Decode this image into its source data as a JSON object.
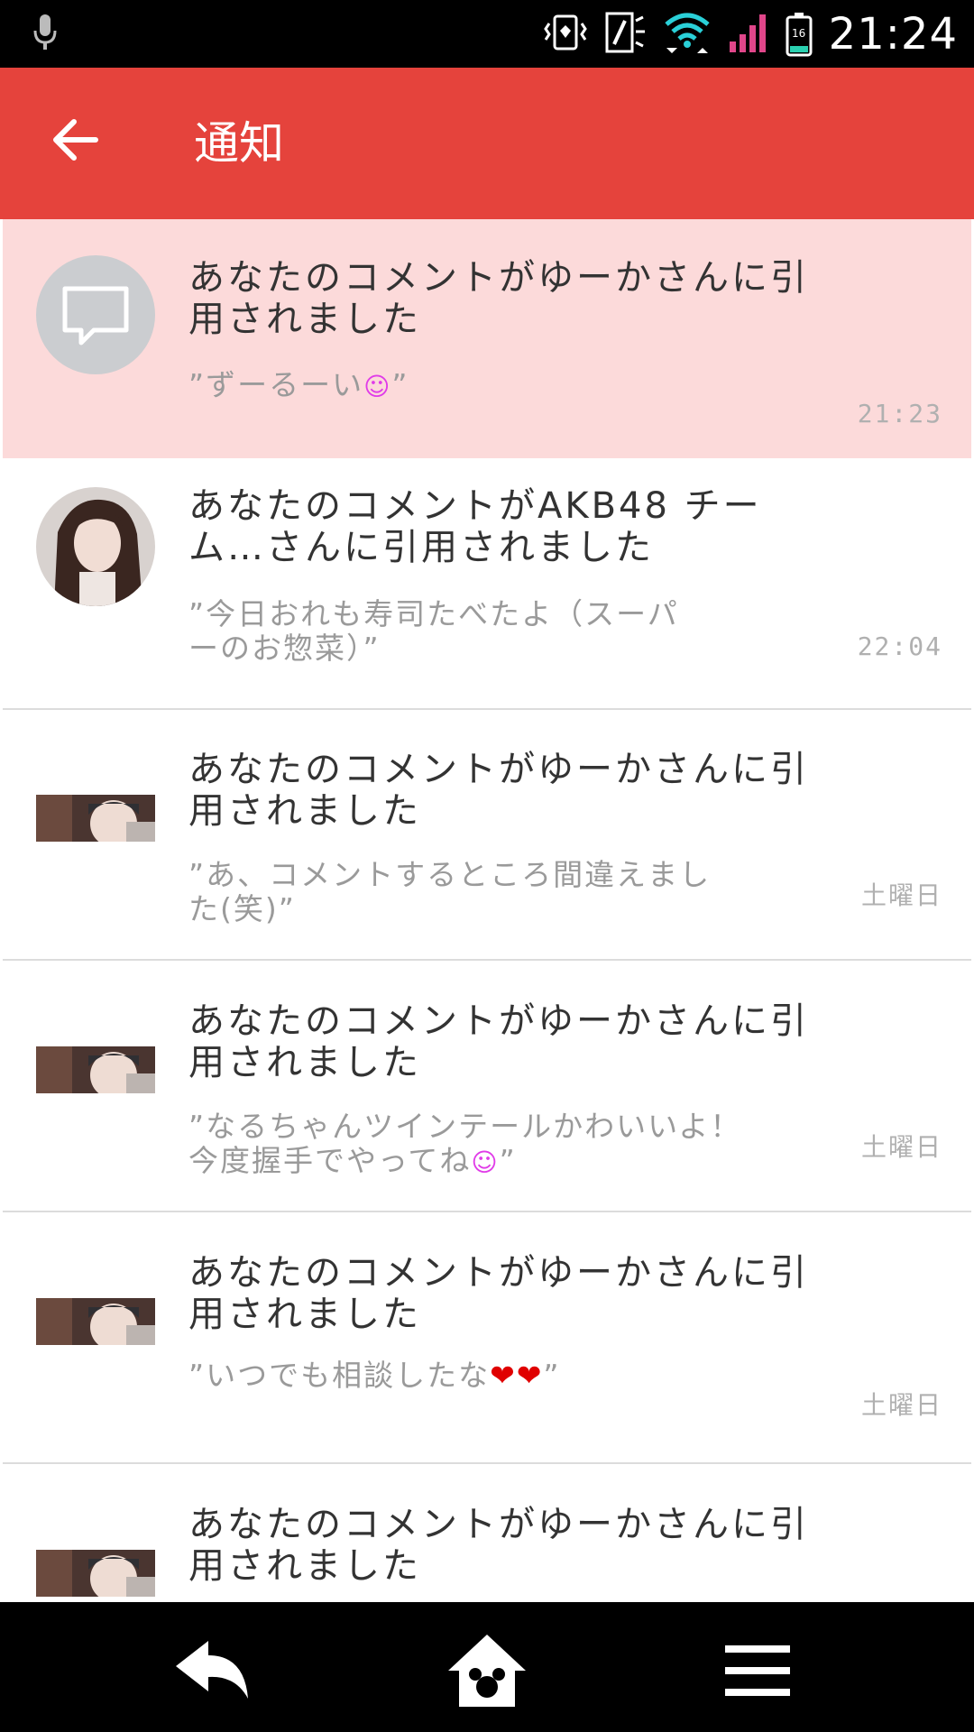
{
  "status_bar": {
    "time": "21:24",
    "battery_level": "16",
    "icons": [
      "mic-icon",
      "vibrate-icon",
      "nfc-icon",
      "wifi-icon",
      "signal-icon",
      "battery-icon"
    ],
    "signal_color": "#e0468a"
  },
  "app_bar": {
    "title": "通知",
    "color": "#e5433c"
  },
  "notifications": [
    {
      "title": "あなたのコメントがゆーかさんに引用されました",
      "quote_text": "”ずーるーい",
      "quote_emoji": "☺",
      "quote_end": "”",
      "time": "21:23",
      "unread": true,
      "avatar": "comment-icon"
    },
    {
      "title": "あなたのコメントがAKB48 チーム…さんに引用されました",
      "quote_text": "”今日おれも寿司たべたよ（スーパーのお惣菜）”",
      "time": "22:04",
      "unread": false,
      "avatar": "user-photo"
    },
    {
      "title": "あなたのコメントがゆーかさんに引用されました",
      "quote_text": "”あ、コメントするところ間違えました(笑)”",
      "time": "土曜日",
      "unread": false,
      "avatar": "user-photo"
    },
    {
      "title": "あなたのコメントがゆーかさんに引用されました",
      "quote_text": "”なるちゃんツインテールかわいいよ！今度握手でやってね",
      "quote_emoji": "☺",
      "quote_end": "”",
      "time": "土曜日",
      "unread": false,
      "avatar": "user-photo"
    },
    {
      "title": "あなたのコメントがゆーかさんに引用されました",
      "quote_text": "”いつでも相談したな",
      "quote_emoji": "❤❤",
      "quote_end": "”",
      "time": "土曜日",
      "unread": false,
      "avatar": "user-photo"
    },
    {
      "title": "あなたのコメントがゆーかさんに引用されました",
      "unread": false,
      "avatar": "user-photo"
    }
  ],
  "bottom_nav": {
    "items": [
      "back-arrow-icon",
      "home-icon",
      "menu-icon"
    ]
  }
}
